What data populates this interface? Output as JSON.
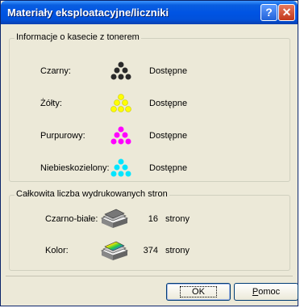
{
  "window": {
    "title": "Materiały eksploatacyjne/liczniki",
    "help_glyph": "?",
    "close_glyph": "✕"
  },
  "toner": {
    "group_label": "Informacje o kasecie z tonerem",
    "items": [
      {
        "label": "Czarny:",
        "status": "Dostępne",
        "color": "#000000"
      },
      {
        "label": "Żółty:",
        "status": "Dostępne",
        "color": "#ffff00"
      },
      {
        "label": "Purpurowy:",
        "status": "Dostępne",
        "color": "#ff00ff"
      },
      {
        "label": "Niebieskozielony:",
        "status": "Dostępne",
        "color": "#00e5ff"
      }
    ]
  },
  "pages": {
    "group_label": "Całkowita liczba wydrukowanych stron",
    "items": [
      {
        "label": "Czarno-białe:",
        "count": "16",
        "unit": "strony"
      },
      {
        "label": "Kolor:",
        "count": "374",
        "unit": "strony"
      }
    ]
  },
  "buttons": {
    "ok": "OK",
    "help_first": "P",
    "help_rest": "omoc"
  }
}
